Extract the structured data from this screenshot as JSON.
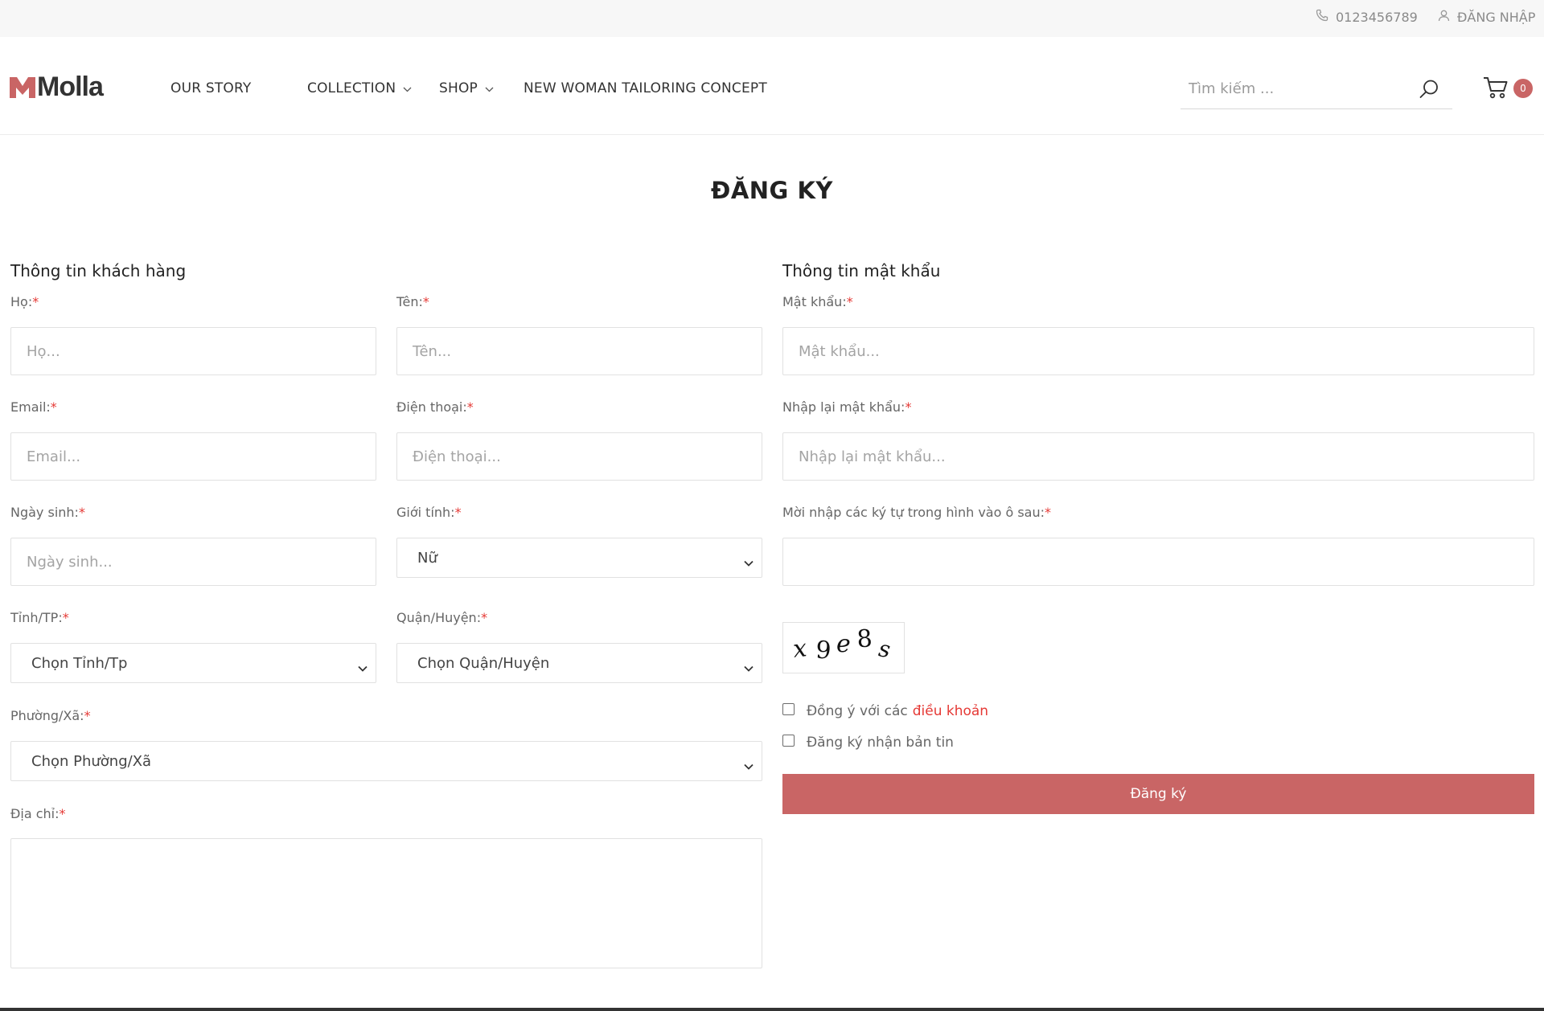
{
  "topbar": {
    "phone": "0123456789",
    "login": "ĐĂNG NHẬP"
  },
  "header": {
    "logo_text": "Molla",
    "nav": [
      {
        "label": "OUR STORY"
      },
      {
        "label": "COLLECTION"
      },
      {
        "label": "SHOP"
      },
      {
        "label": "NEW WOMAN TAILORING CONCEPT"
      }
    ],
    "search_placeholder": "Tìm kiếm ...",
    "cart_count": "0"
  },
  "page": {
    "title": "ĐĂNG KÝ"
  },
  "customer": {
    "section_title": "Thông tin khách hàng",
    "ho_label": "Họ:",
    "ho_placeholder": "Họ...",
    "ten_label": "Tên:",
    "ten_placeholder": "Tên...",
    "email_label": "Email:",
    "email_placeholder": "Email...",
    "phone_label": "Điện thoại:",
    "phone_placeholder": "Điện thoại...",
    "dob_label": "Ngày sinh:",
    "dob_placeholder": "Ngày sinh...",
    "gender_label": "Giới tính:",
    "gender_value": "Nữ",
    "province_label": "Tỉnh/TP:",
    "province_value": "Chọn Tỉnh/Tp",
    "district_label": "Quận/Huyện:",
    "district_value": "Chọn Quận/Huyện",
    "ward_label": "Phường/Xã:",
    "ward_value": "Chọn Phường/Xã",
    "address_label": "Địa chỉ:"
  },
  "password": {
    "section_title": "Thông tin mật khẩu",
    "pw_label": "Mật khẩu:",
    "pw_placeholder": "Mật khẩu...",
    "pw2_label": "Nhập lại mật khẩu:",
    "pw2_placeholder": "Nhập lại mật khẩu...",
    "captcha_label": "Mời nhập các ký tự trong hình vào ô sau:",
    "captcha_text": "x9e8s",
    "terms_prefix": "Đồng ý với các",
    "terms_link": "điều khoản",
    "newsletter": "Đăng ký nhận bản tin",
    "submit": "Đăng ký"
  },
  "required_mark": "*",
  "colors": {
    "accent": "#c96565",
    "required": "#e53935"
  }
}
